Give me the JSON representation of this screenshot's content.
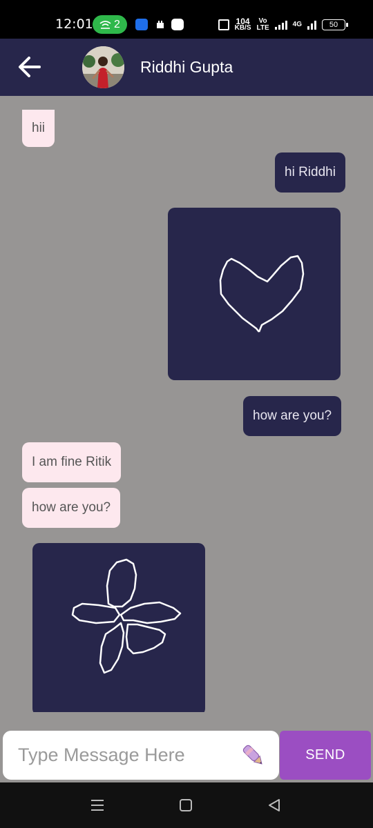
{
  "status_bar": {
    "time": "12:01",
    "hotspot_count": "2",
    "speed_value": "104",
    "speed_unit": "KB/S",
    "volte_top": "Vo",
    "volte_bottom": "LTE",
    "network": "4G",
    "battery": "50",
    "hotspot_color": "#2fb84b"
  },
  "header": {
    "contact_name": "Riddhi Gupta",
    "background": "#27264b"
  },
  "messages": [
    {
      "side": "in",
      "text": "hii"
    },
    {
      "side": "out",
      "text": "hi Riddhi"
    },
    {
      "side": "out",
      "type": "drawing",
      "drawing": "heart"
    },
    {
      "side": "out",
      "text": "how are you?"
    },
    {
      "side": "in",
      "text": "I am fine Ritik"
    },
    {
      "side": "in",
      "text": "how are you?"
    },
    {
      "side": "in",
      "type": "drawing",
      "drawing": "flower"
    }
  ],
  "input": {
    "placeholder": "Type Message Here",
    "value": "",
    "draw_icon": "pen-icon"
  },
  "send_label": "SEND",
  "colors": {
    "incoming_bubble": "#fde8ee",
    "outgoing_bubble": "#27264b",
    "chat_background": "#979594",
    "send_button": "#9b4ec2"
  }
}
